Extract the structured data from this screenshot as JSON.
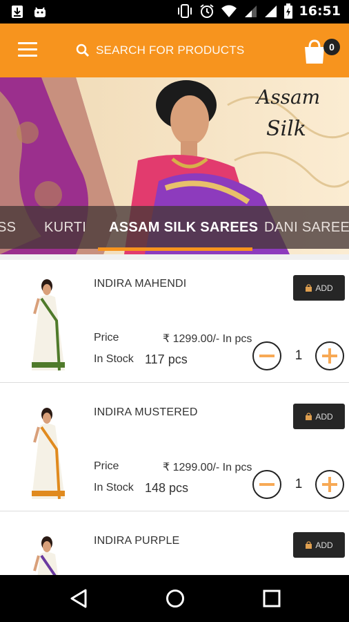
{
  "status_bar": {
    "time": "16:51",
    "icons": [
      "download-icon",
      "android-icon",
      "vibrate-icon",
      "alarm-icon",
      "wifi-icon",
      "signal-icon",
      "signal-icon",
      "battery-icon"
    ]
  },
  "app_bar": {
    "menu_icon": "hamburger-menu-icon",
    "search_placeholder": "SEARCH FOR PRODUCTS",
    "cart_count": "0",
    "accent_color": "#f7941e"
  },
  "banner": {
    "title_line1": "Assam",
    "title_line2": "Silk",
    "categories": [
      "SS",
      "KURTI",
      "ASSAM SILK SAREES",
      "DANI SAREES"
    ],
    "active_category": "ASSAM SILK SAREES"
  },
  "products": [
    {
      "name": "INDIRA MAHENDI",
      "price_label": "Price",
      "price": "₹ 1299.00/- In pcs",
      "stock_label": "In Stock",
      "stock": "117 pcs",
      "quantity": "1",
      "add_label": "ADD",
      "border_color": "#4f7a2a"
    },
    {
      "name": "INDIRA MUSTERED",
      "price_label": "Price",
      "price": "₹ 1299.00/- In pcs",
      "stock_label": "In Stock",
      "stock": "148 pcs",
      "quantity": "1",
      "add_label": "ADD",
      "border_color": "#e08a1e"
    },
    {
      "name": "INDIRA PURPLE",
      "add_label": "ADD",
      "border_color": "#6a3aa0"
    }
  ]
}
